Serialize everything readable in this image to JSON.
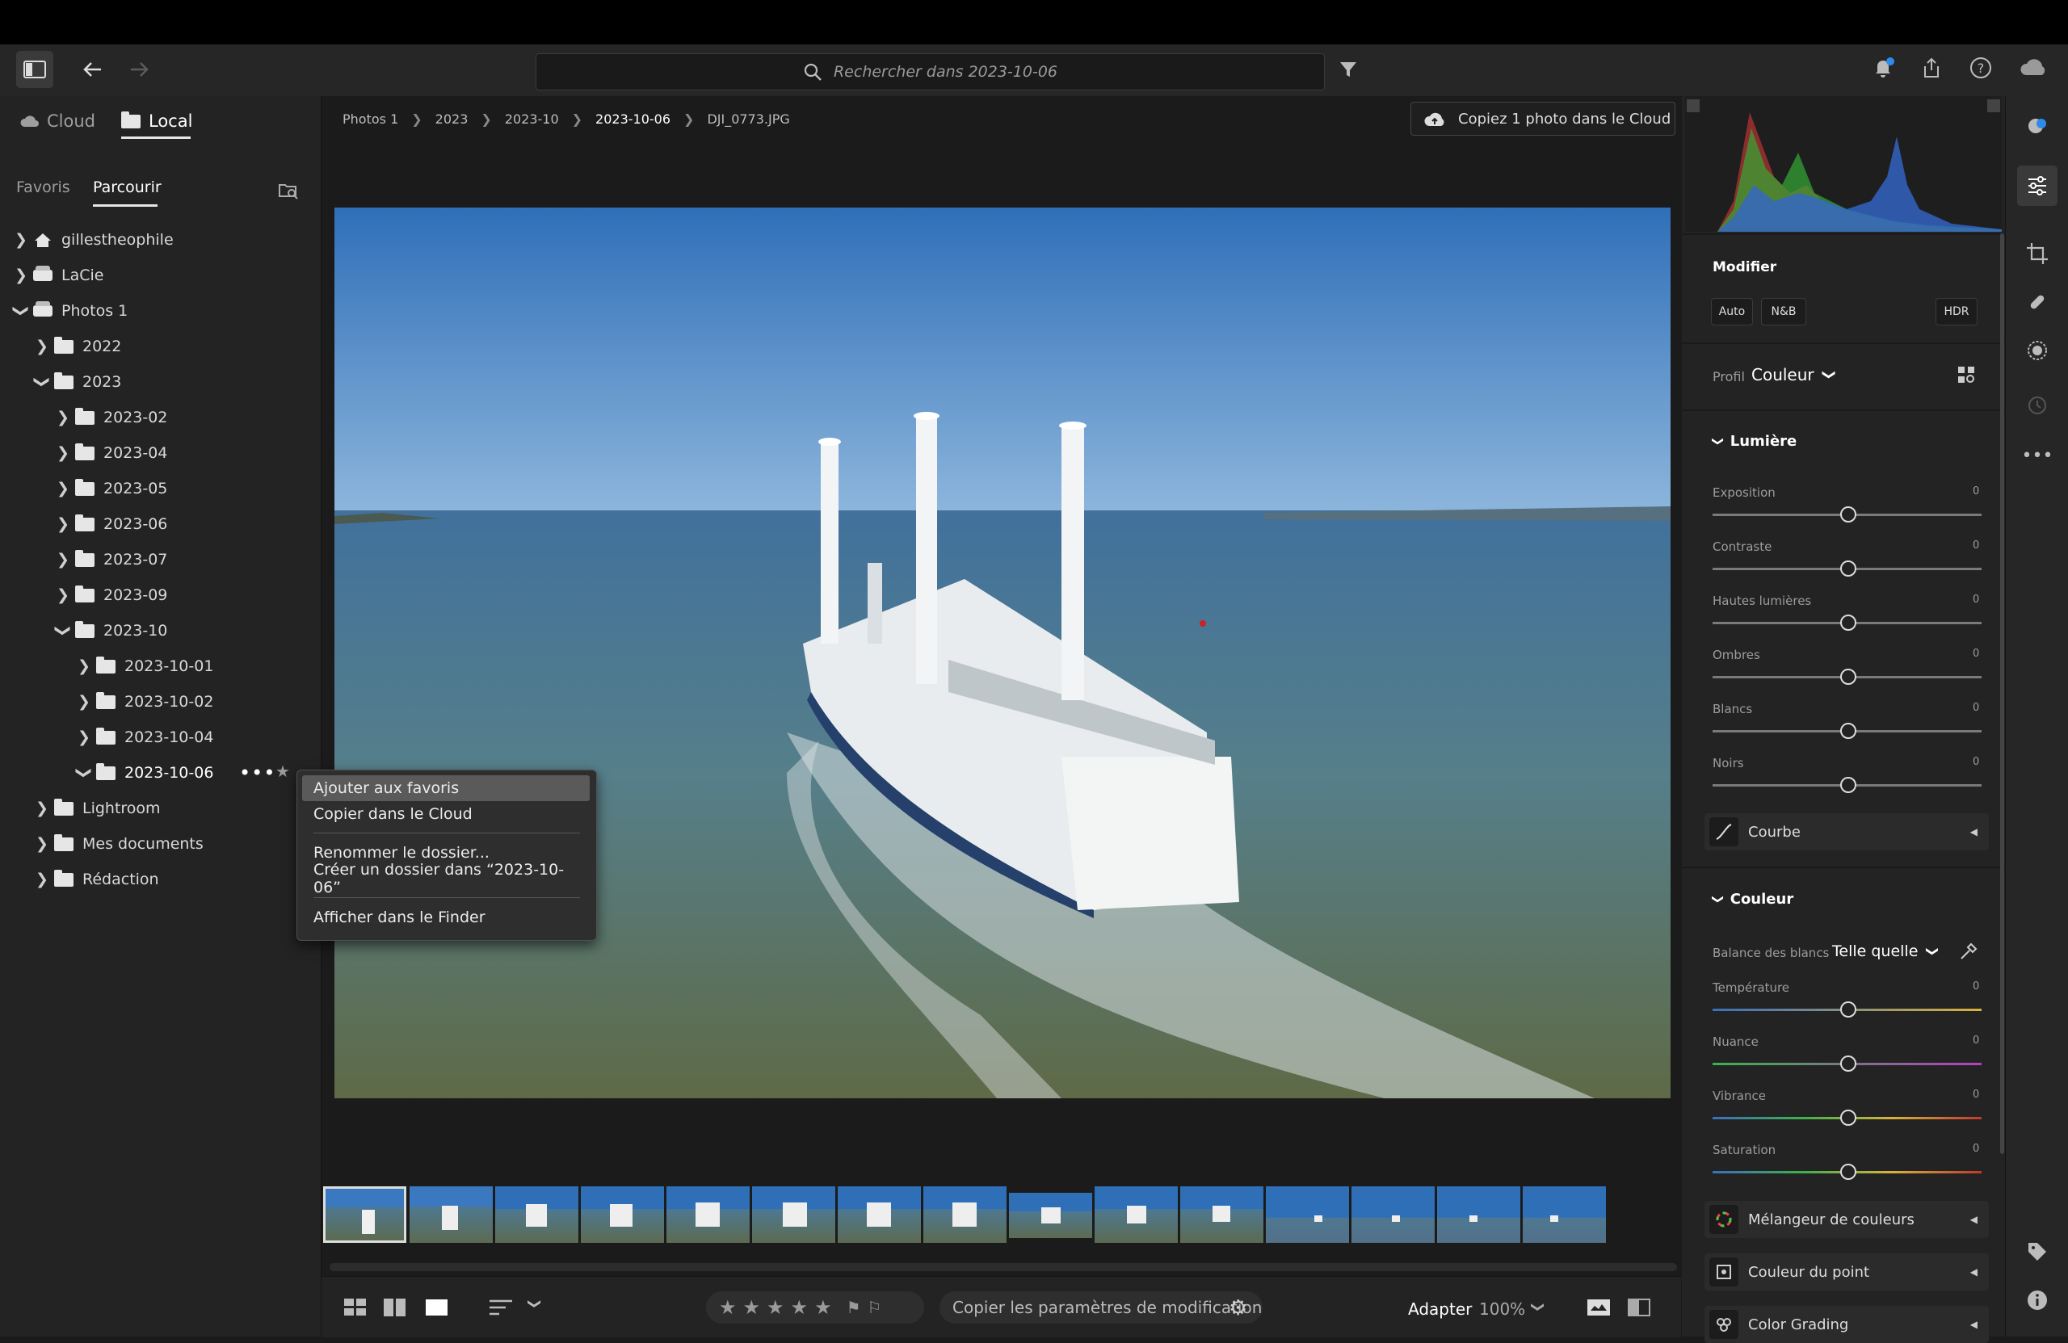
{
  "search": {
    "placeholder": "Rechercher dans 2023-10-06"
  },
  "source_tabs": {
    "cloud": "Cloud",
    "local": "Local"
  },
  "browse_tabs": {
    "favorites": "Favoris",
    "browse": "Parcourir"
  },
  "tree": [
    {
      "label": "gillestheophile"
    },
    {
      "label": "LaCie"
    },
    {
      "label": "Photos 1"
    },
    {
      "label": "2022"
    },
    {
      "label": "2023"
    },
    {
      "label": "2023-02"
    },
    {
      "label": "2023-04"
    },
    {
      "label": "2023-05"
    },
    {
      "label": "2023-06"
    },
    {
      "label": "2023-07"
    },
    {
      "label": "2023-09"
    },
    {
      "label": "2023-10"
    },
    {
      "label": "2023-10-01"
    },
    {
      "label": "2023-10-02"
    },
    {
      "label": "2023-10-04"
    },
    {
      "label": "2023-10-06"
    },
    {
      "label": "Lightroom"
    },
    {
      "label": "Mes documents"
    },
    {
      "label": "Rédaction"
    }
  ],
  "breadcrumb": [
    "Photos 1",
    "2023",
    "2023-10",
    "2023-10-06",
    "DJI_0773.JPG"
  ],
  "copy_cloud_button": "Copiez 1 photo dans le Cloud",
  "context_menu": {
    "add_favorites": "Ajouter aux favoris",
    "copy_cloud": "Copier dans le Cloud",
    "rename": "Renommer le dossier...",
    "create": "Créer un dossier dans “2023-10-06”",
    "finder": "Afficher dans le Finder"
  },
  "edit": {
    "title": "Modifier",
    "auto": "Auto",
    "bw": "N&B",
    "hdr": "HDR",
    "profile_label": "Profil",
    "profile_value": "Couleur",
    "light_title": "Lumière",
    "light": [
      {
        "label": "Exposition",
        "value": "0"
      },
      {
        "label": "Contraste",
        "value": "0"
      },
      {
        "label": "Hautes lumières",
        "value": "0"
      },
      {
        "label": "Ombres",
        "value": "0"
      },
      {
        "label": "Blancs",
        "value": "0"
      },
      {
        "label": "Noirs",
        "value": "0"
      }
    ],
    "curve": "Courbe",
    "color_title": "Couleur",
    "wb_label": "Balance des blancs",
    "wb_value": "Telle quelle",
    "color": [
      {
        "label": "Température",
        "value": "0"
      },
      {
        "label": "Nuance",
        "value": "0"
      },
      {
        "label": "Vibrance",
        "value": "0"
      },
      {
        "label": "Saturation",
        "value": "0"
      }
    ],
    "mixer": "Mélangeur de couleurs",
    "point_color": "Couleur du point",
    "grading": "Color Grading"
  },
  "bottom": {
    "copy_settings": "Copier les paramètres de modification",
    "fit": "Adapter",
    "zoom": "100%"
  },
  "colors": {
    "accent_blue": "#2d8ceb",
    "panel": "#232323",
    "background": "#1b1b1b"
  }
}
